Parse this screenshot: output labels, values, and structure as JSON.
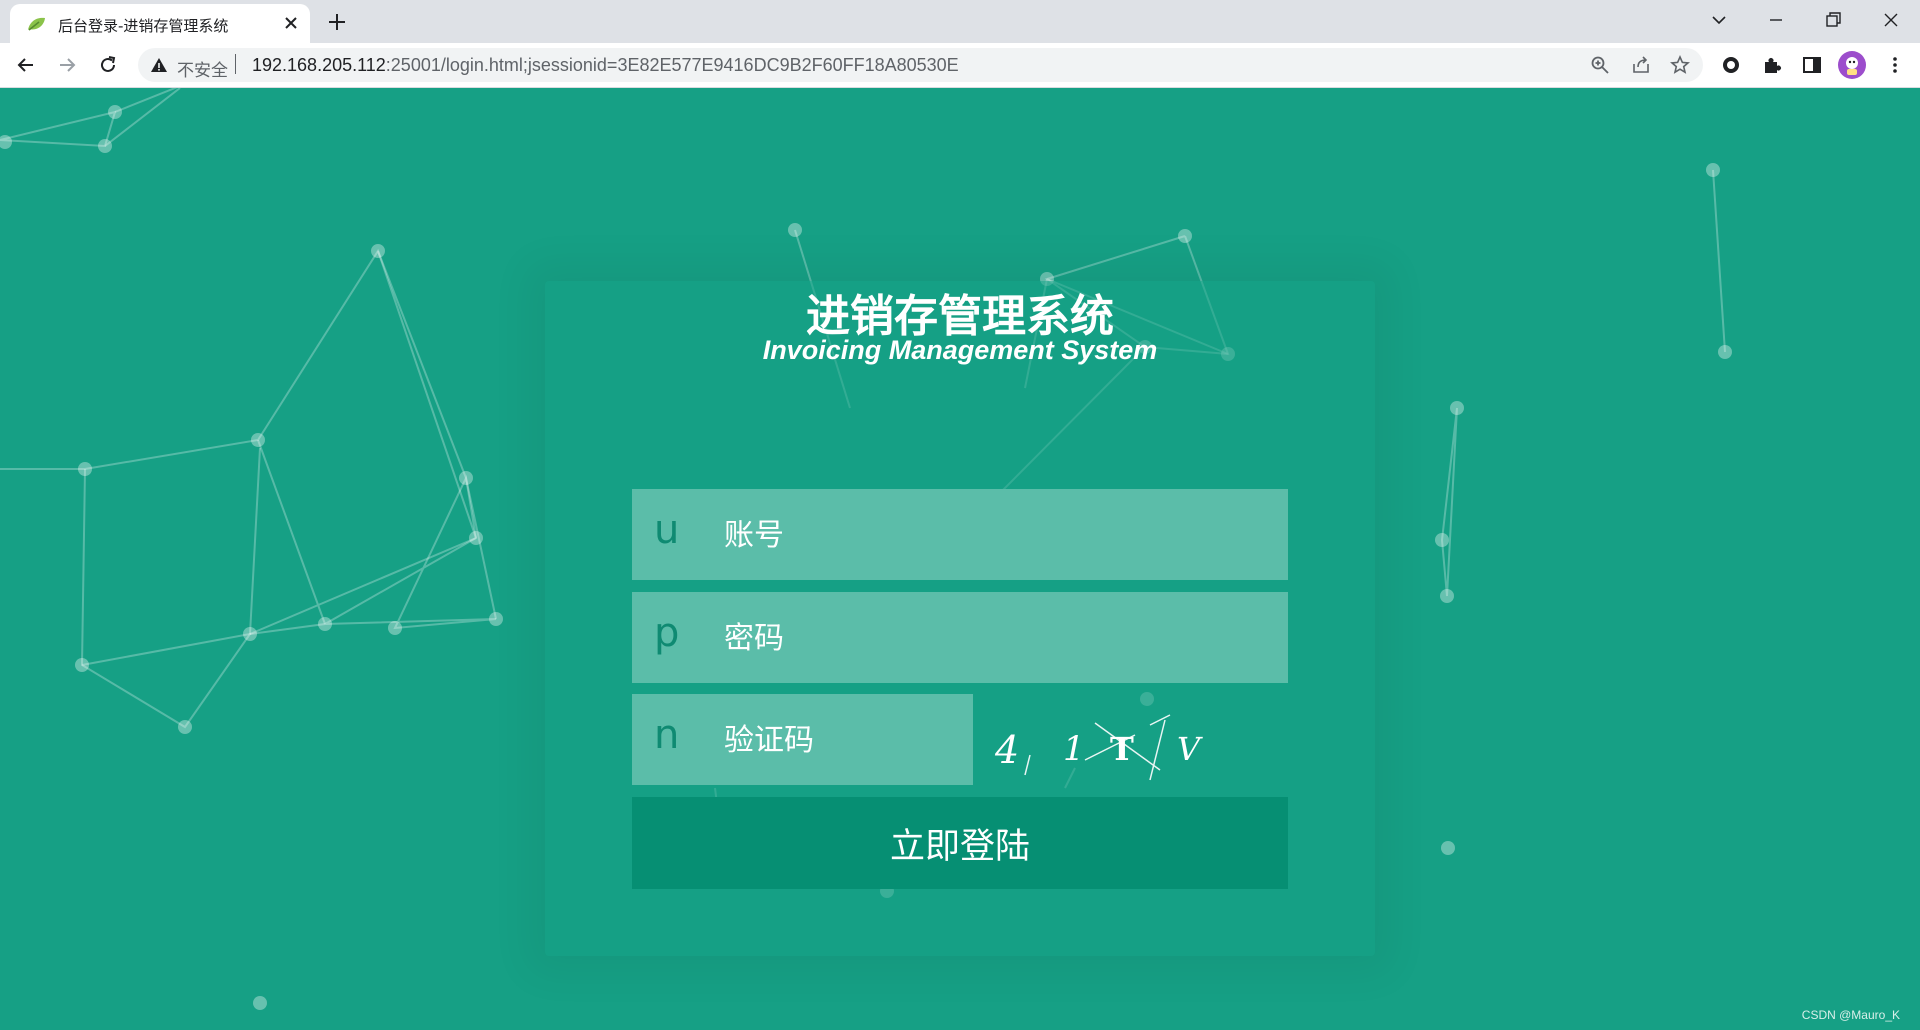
{
  "browser": {
    "tab_title": "后台登录-进销存管理系统",
    "security_label": "不安全",
    "url_host": "192.168.205.112",
    "url_rest": ":25001/login.html;jsessionid=3E82E577E9416DC9B2F60FF18A80530E"
  },
  "login": {
    "title_cn": "进销存管理系统",
    "title_en": "Invoicing Management System",
    "username": {
      "icon_letter": "u",
      "placeholder": "账号",
      "value": ""
    },
    "password": {
      "icon_letter": "p",
      "placeholder": "密码",
      "value": ""
    },
    "captcha": {
      "icon_letter": "n",
      "placeholder": "验证码",
      "value": "",
      "image_text": "4 1 T V"
    },
    "submit_label": "立即登陆"
  },
  "watermark": "CSDN @Mauro_K",
  "colors": {
    "background": "#16a085",
    "field": "#5bbda9",
    "button": "#068f73"
  }
}
